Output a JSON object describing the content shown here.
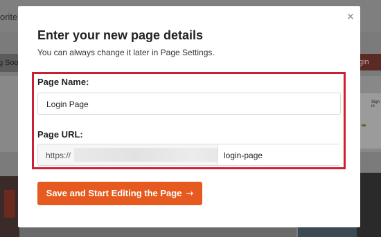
{
  "background": {
    "topbar_text": "orite",
    "left_button": "g Soo",
    "right_button": "gin",
    "side_card_text": "Sign in"
  },
  "modal": {
    "close_icon": "×",
    "title": "Enter your new page details",
    "subtitle": "You can always change it later in Page Settings.",
    "page_name_label": "Page Name:",
    "page_name_value": "Login Page",
    "page_url_label": "Page URL:",
    "url_prefix": "https://",
    "url_slug": "login-page",
    "save_button_label": "Save and Start Editing the Page",
    "save_button_arrow": "→",
    "accent_color": "#e65a1f",
    "highlight_color": "#cc2030"
  }
}
